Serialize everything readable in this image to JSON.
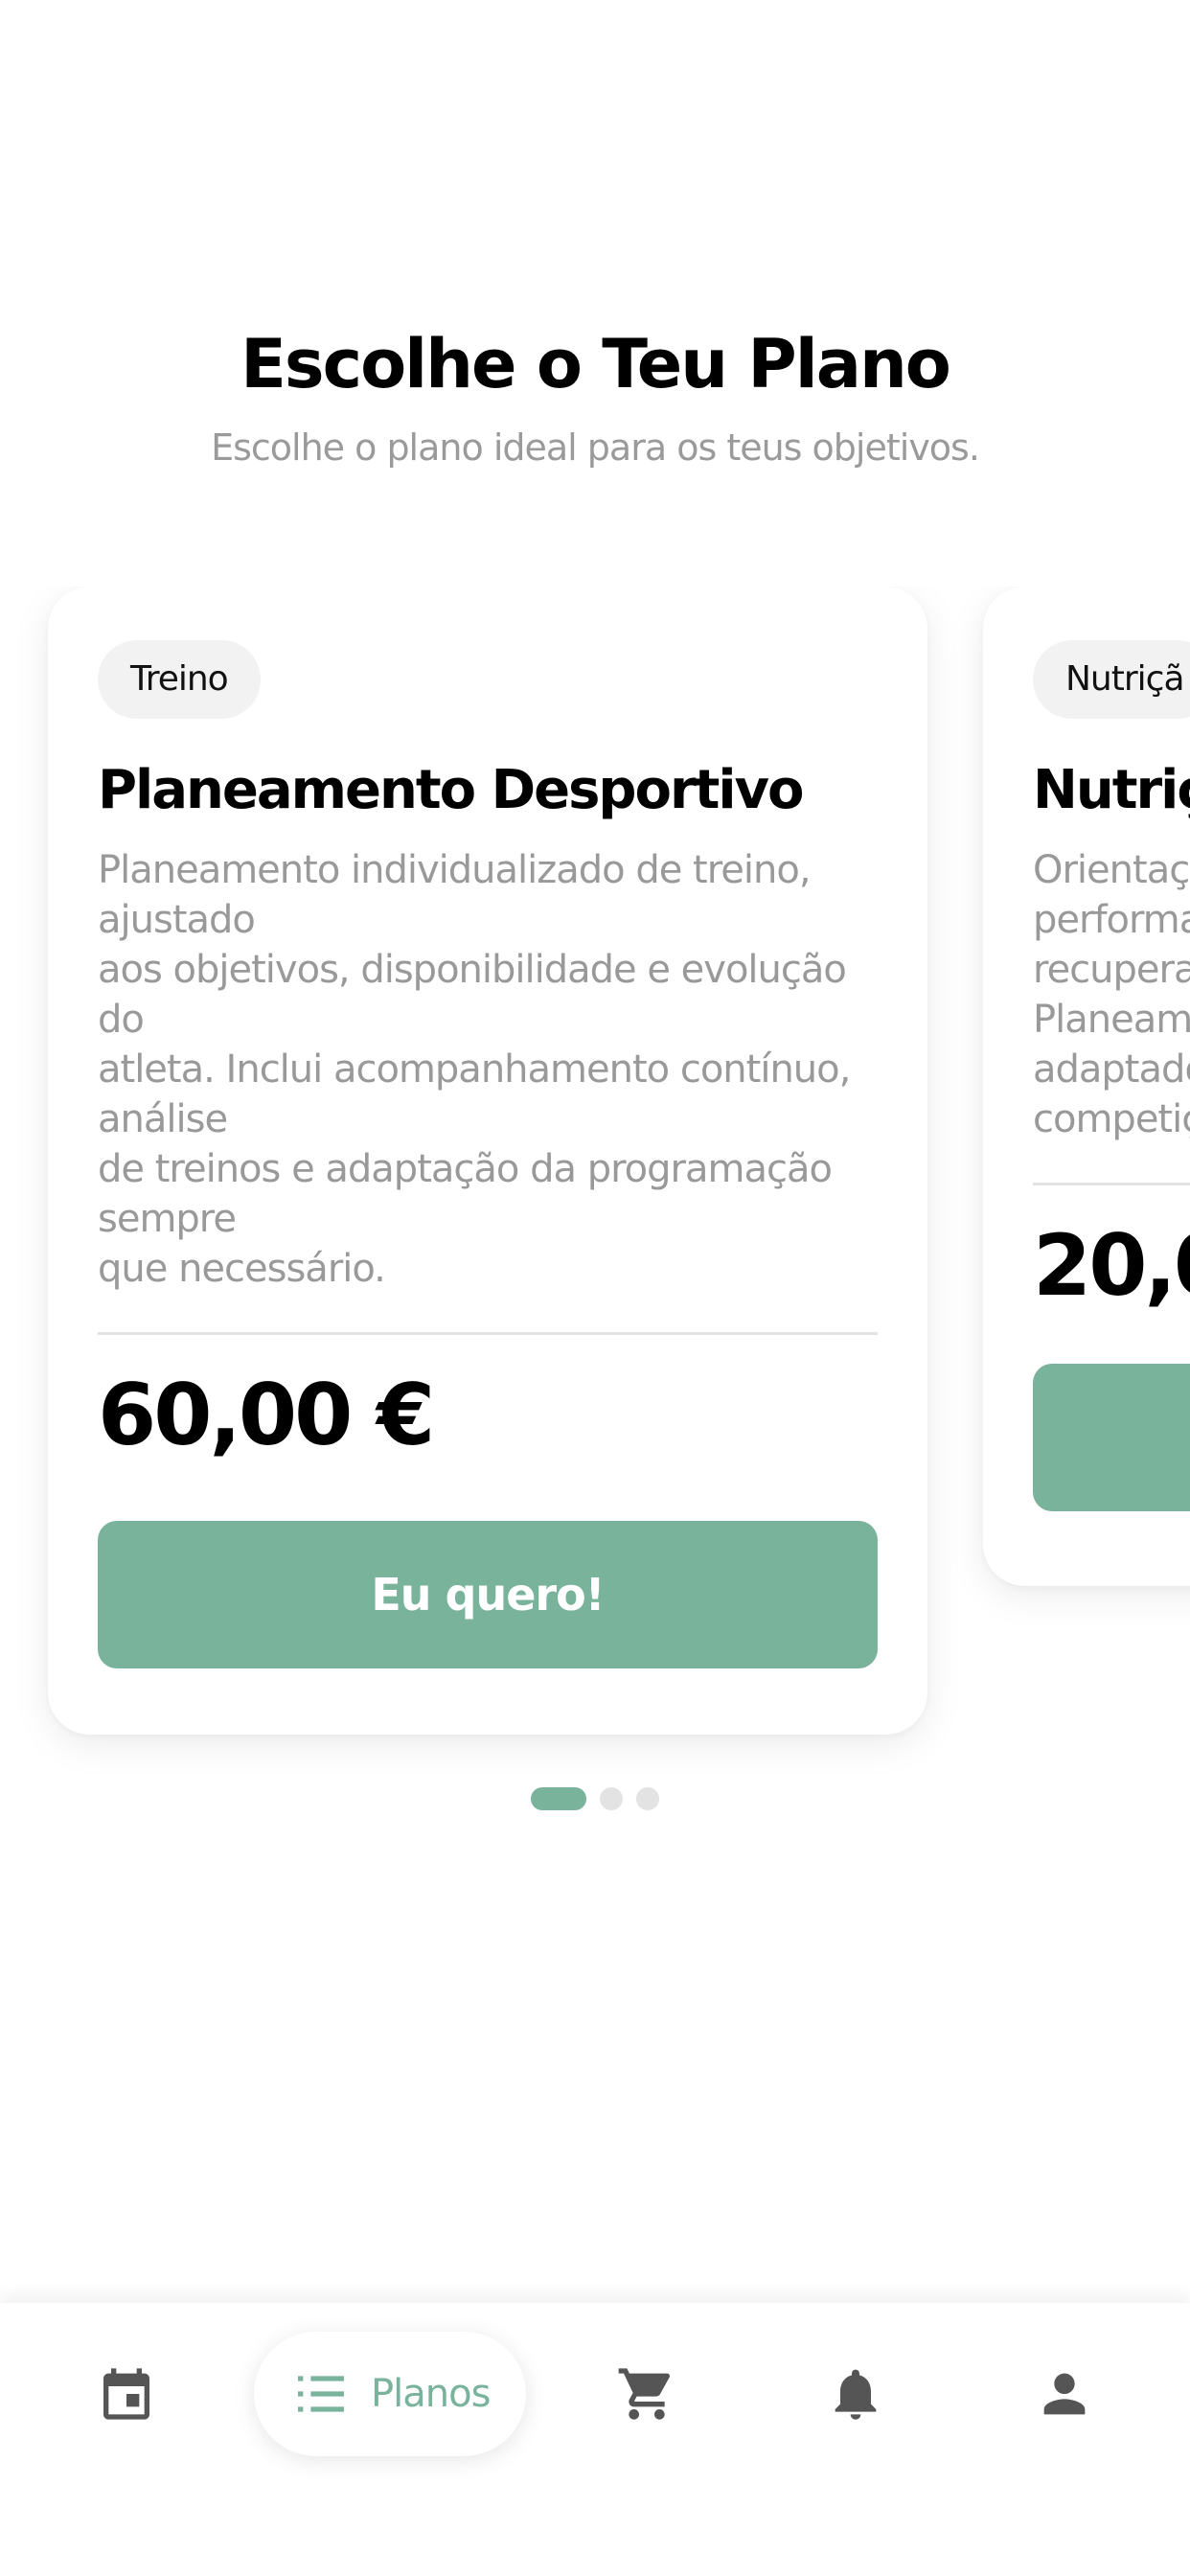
{
  "header": {
    "title": "Escolhe o Teu Plano",
    "subtitle": "Escolhe o plano ideal para os teus objetivos."
  },
  "plans": [
    {
      "tag": "Treino",
      "title": "Planeamento Desportivo",
      "description": "Planeamento individualizado de treino,\najustado\naos objetivos, disponibilidade e evolução\ndo\natleta. Inclui acompanhamento contínuo,\nanálise\nde treinos e adaptação da programação\nsempre\nque necessário.",
      "price": "60,00 €",
      "button_label": "Eu quero!"
    },
    {
      "tag": "Nutriçã",
      "title": "Nutriç",
      "description": "Orientaç\nperforma\nrecupera\nPlaneam\nadaptado\ncompetiç",
      "price": "20,0",
      "button_label": ""
    }
  ],
  "carousel": {
    "page_count": 3,
    "active_index": 0
  },
  "bottom_nav": {
    "items": [
      {
        "icon": "calendar-icon",
        "label": ""
      },
      {
        "icon": "list-icon",
        "label": "Planos"
      },
      {
        "icon": "cart-icon",
        "label": ""
      },
      {
        "icon": "bell-icon",
        "label": ""
      },
      {
        "icon": "person-icon",
        "label": ""
      }
    ],
    "active_index": 1
  },
  "colors": {
    "accent": "#79b39c",
    "text": "#000000",
    "muted": "#999999"
  }
}
